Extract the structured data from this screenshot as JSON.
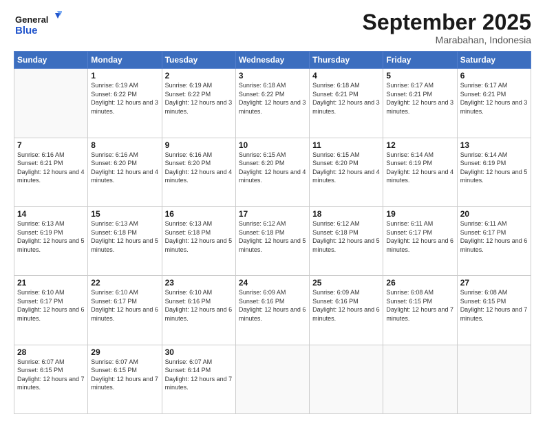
{
  "logo": {
    "text_general": "General",
    "text_blue": "Blue"
  },
  "header": {
    "month": "September 2025",
    "location": "Marabahan, Indonesia"
  },
  "weekdays": [
    "Sunday",
    "Monday",
    "Tuesday",
    "Wednesday",
    "Thursday",
    "Friday",
    "Saturday"
  ],
  "weeks": [
    [
      {
        "day": "",
        "empty": true
      },
      {
        "day": "1",
        "sunrise": "6:19 AM",
        "sunset": "6:22 PM",
        "daylight": "12 hours and 3 minutes."
      },
      {
        "day": "2",
        "sunrise": "6:19 AM",
        "sunset": "6:22 PM",
        "daylight": "12 hours and 3 minutes."
      },
      {
        "day": "3",
        "sunrise": "6:18 AM",
        "sunset": "6:22 PM",
        "daylight": "12 hours and 3 minutes."
      },
      {
        "day": "4",
        "sunrise": "6:18 AM",
        "sunset": "6:21 PM",
        "daylight": "12 hours and 3 minutes."
      },
      {
        "day": "5",
        "sunrise": "6:17 AM",
        "sunset": "6:21 PM",
        "daylight": "12 hours and 3 minutes."
      },
      {
        "day": "6",
        "sunrise": "6:17 AM",
        "sunset": "6:21 PM",
        "daylight": "12 hours and 3 minutes."
      }
    ],
    [
      {
        "day": "7",
        "sunrise": "6:16 AM",
        "sunset": "6:21 PM",
        "daylight": "12 hours and 4 minutes."
      },
      {
        "day": "8",
        "sunrise": "6:16 AM",
        "sunset": "6:20 PM",
        "daylight": "12 hours and 4 minutes."
      },
      {
        "day": "9",
        "sunrise": "6:16 AM",
        "sunset": "6:20 PM",
        "daylight": "12 hours and 4 minutes."
      },
      {
        "day": "10",
        "sunrise": "6:15 AM",
        "sunset": "6:20 PM",
        "daylight": "12 hours and 4 minutes."
      },
      {
        "day": "11",
        "sunrise": "6:15 AM",
        "sunset": "6:20 PM",
        "daylight": "12 hours and 4 minutes."
      },
      {
        "day": "12",
        "sunrise": "6:14 AM",
        "sunset": "6:19 PM",
        "daylight": "12 hours and 4 minutes."
      },
      {
        "day": "13",
        "sunrise": "6:14 AM",
        "sunset": "6:19 PM",
        "daylight": "12 hours and 5 minutes."
      }
    ],
    [
      {
        "day": "14",
        "sunrise": "6:13 AM",
        "sunset": "6:19 PM",
        "daylight": "12 hours and 5 minutes."
      },
      {
        "day": "15",
        "sunrise": "6:13 AM",
        "sunset": "6:18 PM",
        "daylight": "12 hours and 5 minutes."
      },
      {
        "day": "16",
        "sunrise": "6:13 AM",
        "sunset": "6:18 PM",
        "daylight": "12 hours and 5 minutes."
      },
      {
        "day": "17",
        "sunrise": "6:12 AM",
        "sunset": "6:18 PM",
        "daylight": "12 hours and 5 minutes."
      },
      {
        "day": "18",
        "sunrise": "6:12 AM",
        "sunset": "6:18 PM",
        "daylight": "12 hours and 5 minutes."
      },
      {
        "day": "19",
        "sunrise": "6:11 AM",
        "sunset": "6:17 PM",
        "daylight": "12 hours and 6 minutes."
      },
      {
        "day": "20",
        "sunrise": "6:11 AM",
        "sunset": "6:17 PM",
        "daylight": "12 hours and 6 minutes."
      }
    ],
    [
      {
        "day": "21",
        "sunrise": "6:10 AM",
        "sunset": "6:17 PM",
        "daylight": "12 hours and 6 minutes."
      },
      {
        "day": "22",
        "sunrise": "6:10 AM",
        "sunset": "6:17 PM",
        "daylight": "12 hours and 6 minutes."
      },
      {
        "day": "23",
        "sunrise": "6:10 AM",
        "sunset": "6:16 PM",
        "daylight": "12 hours and 6 minutes."
      },
      {
        "day": "24",
        "sunrise": "6:09 AM",
        "sunset": "6:16 PM",
        "daylight": "12 hours and 6 minutes."
      },
      {
        "day": "25",
        "sunrise": "6:09 AM",
        "sunset": "6:16 PM",
        "daylight": "12 hours and 6 minutes."
      },
      {
        "day": "26",
        "sunrise": "6:08 AM",
        "sunset": "6:15 PM",
        "daylight": "12 hours and 7 minutes."
      },
      {
        "day": "27",
        "sunrise": "6:08 AM",
        "sunset": "6:15 PM",
        "daylight": "12 hours and 7 minutes."
      }
    ],
    [
      {
        "day": "28",
        "sunrise": "6:07 AM",
        "sunset": "6:15 PM",
        "daylight": "12 hours and 7 minutes."
      },
      {
        "day": "29",
        "sunrise": "6:07 AM",
        "sunset": "6:15 PM",
        "daylight": "12 hours and 7 minutes."
      },
      {
        "day": "30",
        "sunrise": "6:07 AM",
        "sunset": "6:14 PM",
        "daylight": "12 hours and 7 minutes."
      },
      {
        "day": "",
        "empty": true
      },
      {
        "day": "",
        "empty": true
      },
      {
        "day": "",
        "empty": true
      },
      {
        "day": "",
        "empty": true
      }
    ]
  ]
}
